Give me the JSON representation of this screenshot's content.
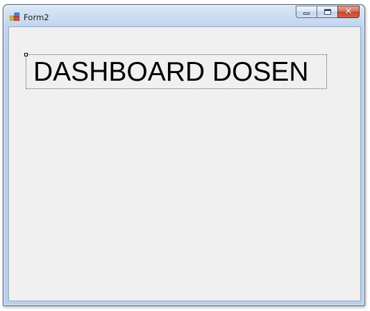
{
  "window": {
    "title": "Form2",
    "accent_colors": {
      "titlebar": "#c3d6ee",
      "close_button": "#c14a33",
      "client_background": "#f0f0f0"
    }
  },
  "caption_buttons": {
    "minimize_icon": "minimize-icon",
    "maximize_icon": "maximize-icon",
    "close_icon": "close-icon",
    "close_glyph": "✕"
  },
  "form": {
    "heading": "DASHBOARD DOSEN"
  }
}
